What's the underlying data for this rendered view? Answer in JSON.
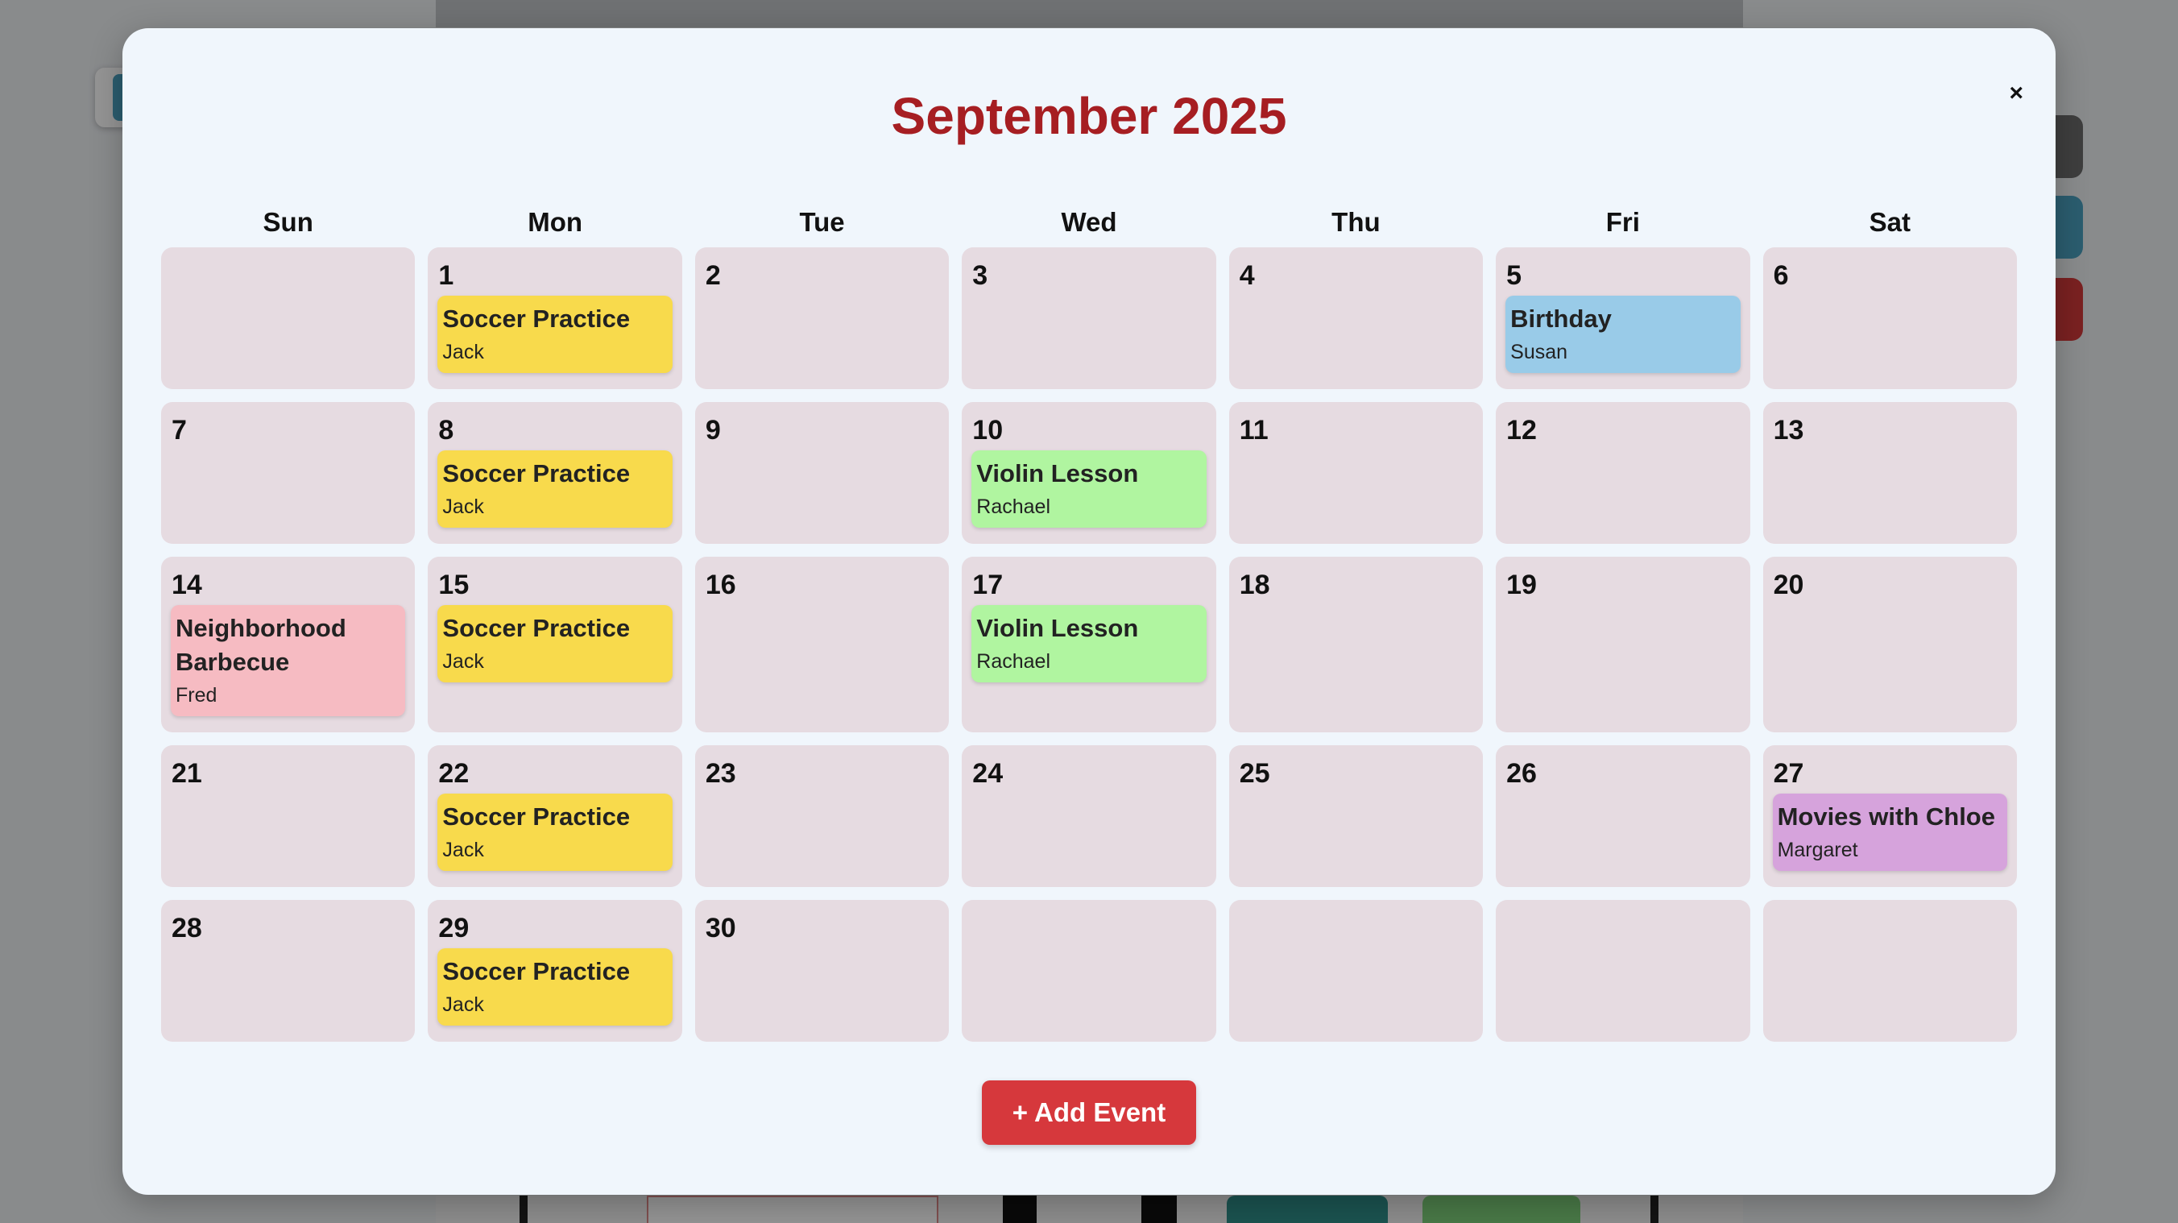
{
  "modal": {
    "title": "September 2025",
    "close_label": "×",
    "add_button_label": "+ Add Event"
  },
  "weekdays": [
    "Sun",
    "Mon",
    "Tue",
    "Wed",
    "Thu",
    "Fri",
    "Sat"
  ],
  "colors": {
    "soccer": "#f8da4c",
    "birthday": "#99cbe8",
    "violin": "#b0f5a0",
    "barbecue": "#f6bbc2",
    "movies": "#d6a3dc",
    "title": "#a61e22",
    "add_button": "#d6383c",
    "day_cell": "#e6dbe1"
  },
  "days": [
    {
      "num": "",
      "events": []
    },
    {
      "num": "1",
      "events": [
        {
          "title": "Soccer Practice",
          "person": "Jack",
          "color": "#f8da4c"
        }
      ]
    },
    {
      "num": "2",
      "events": []
    },
    {
      "num": "3",
      "events": []
    },
    {
      "num": "4",
      "events": []
    },
    {
      "num": "5",
      "events": [
        {
          "title": "Birthday",
          "person": "Susan",
          "color": "#99cbe8"
        }
      ]
    },
    {
      "num": "6",
      "events": []
    },
    {
      "num": "7",
      "events": []
    },
    {
      "num": "8",
      "events": [
        {
          "title": "Soccer Practice",
          "person": "Jack",
          "color": "#f8da4c"
        }
      ]
    },
    {
      "num": "9",
      "events": []
    },
    {
      "num": "10",
      "events": [
        {
          "title": "Violin Lesson",
          "person": "Rachael",
          "color": "#b0f5a0"
        }
      ]
    },
    {
      "num": "11",
      "events": []
    },
    {
      "num": "12",
      "events": []
    },
    {
      "num": "13",
      "events": []
    },
    {
      "num": "14",
      "events": [
        {
          "title": "Neighborhood Barbecue",
          "person": "Fred",
          "color": "#f6bbc2"
        }
      ]
    },
    {
      "num": "15",
      "events": [
        {
          "title": "Soccer Practice",
          "person": "Jack",
          "color": "#f8da4c"
        }
      ]
    },
    {
      "num": "16",
      "events": []
    },
    {
      "num": "17",
      "events": [
        {
          "title": "Violin Lesson",
          "person": "Rachael",
          "color": "#b0f5a0"
        }
      ]
    },
    {
      "num": "18",
      "events": []
    },
    {
      "num": "19",
      "events": []
    },
    {
      "num": "20",
      "events": []
    },
    {
      "num": "21",
      "events": []
    },
    {
      "num": "22",
      "events": [
        {
          "title": "Soccer Practice",
          "person": "Jack",
          "color": "#f8da4c"
        }
      ]
    },
    {
      "num": "23",
      "events": []
    },
    {
      "num": "24",
      "events": []
    },
    {
      "num": "25",
      "events": []
    },
    {
      "num": "26",
      "events": []
    },
    {
      "num": "27",
      "events": [
        {
          "title": "Movies with Chloe",
          "person": "Margaret",
          "color": "#d6a3dc"
        }
      ]
    },
    {
      "num": "28",
      "events": []
    },
    {
      "num": "29",
      "events": [
        {
          "title": "Soccer Practice",
          "person": "Jack",
          "color": "#f8da4c"
        }
      ]
    },
    {
      "num": "30",
      "events": []
    },
    {
      "num": "",
      "events": []
    },
    {
      "num": "",
      "events": []
    },
    {
      "num": "",
      "events": []
    },
    {
      "num": "",
      "events": []
    }
  ]
}
